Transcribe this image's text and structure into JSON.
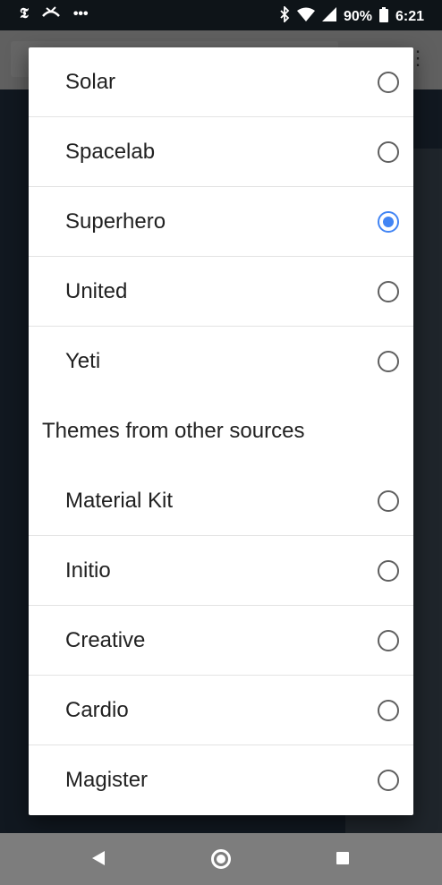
{
  "status_bar": {
    "left_icons": [
      "nyt-icon",
      "missed-call-icon",
      "more-notifications-icon"
    ],
    "battery": "90%",
    "time": "6:21"
  },
  "theme_dialog": {
    "items_top": [
      {
        "label": "Solar",
        "checked": false
      },
      {
        "label": "Spacelab",
        "checked": false
      },
      {
        "label": "Superhero",
        "checked": true
      },
      {
        "label": "United",
        "checked": false
      },
      {
        "label": "Yeti",
        "checked": false
      }
    ],
    "section_header": "Themes from other sources",
    "items_other": [
      {
        "label": "Material Kit",
        "checked": false
      },
      {
        "label": "Initio",
        "checked": false
      },
      {
        "label": "Creative",
        "checked": false
      },
      {
        "label": "Cardio",
        "checked": false
      },
      {
        "label": "Magister",
        "checked": false
      }
    ]
  },
  "colors": {
    "accent_radio": "#4285f4",
    "background_page": "#2b3e50",
    "background_link": "#df691a"
  }
}
